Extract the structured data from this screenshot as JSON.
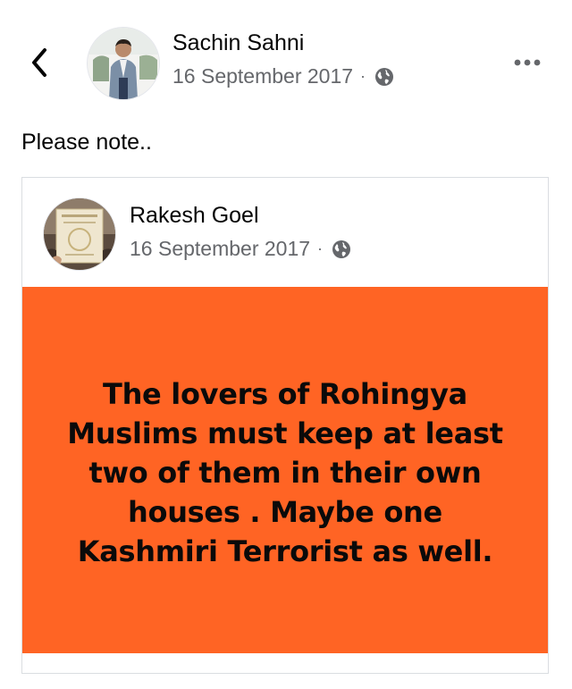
{
  "post": {
    "author_name": "Sachin Sahni",
    "date": "16 September 2017",
    "separator": "·",
    "privacy_icon": "globe-icon",
    "text": "Please note.."
  },
  "nav": {
    "back_icon": "chevron-left-icon",
    "more_icon": "more-horizontal-icon"
  },
  "shared_post": {
    "author_name": "Rakesh Goel",
    "date": "16 September 2017",
    "separator": "·",
    "privacy_icon": "globe-icon",
    "banner_text": "The lovers of Rohingya Muslims must keep at least two of them in their own houses . Maybe one Kashmiri Terrorist as well.",
    "banner_color": "#ff6424"
  },
  "colors": {
    "meta_text": "#65676b",
    "primary_text": "#050505"
  }
}
